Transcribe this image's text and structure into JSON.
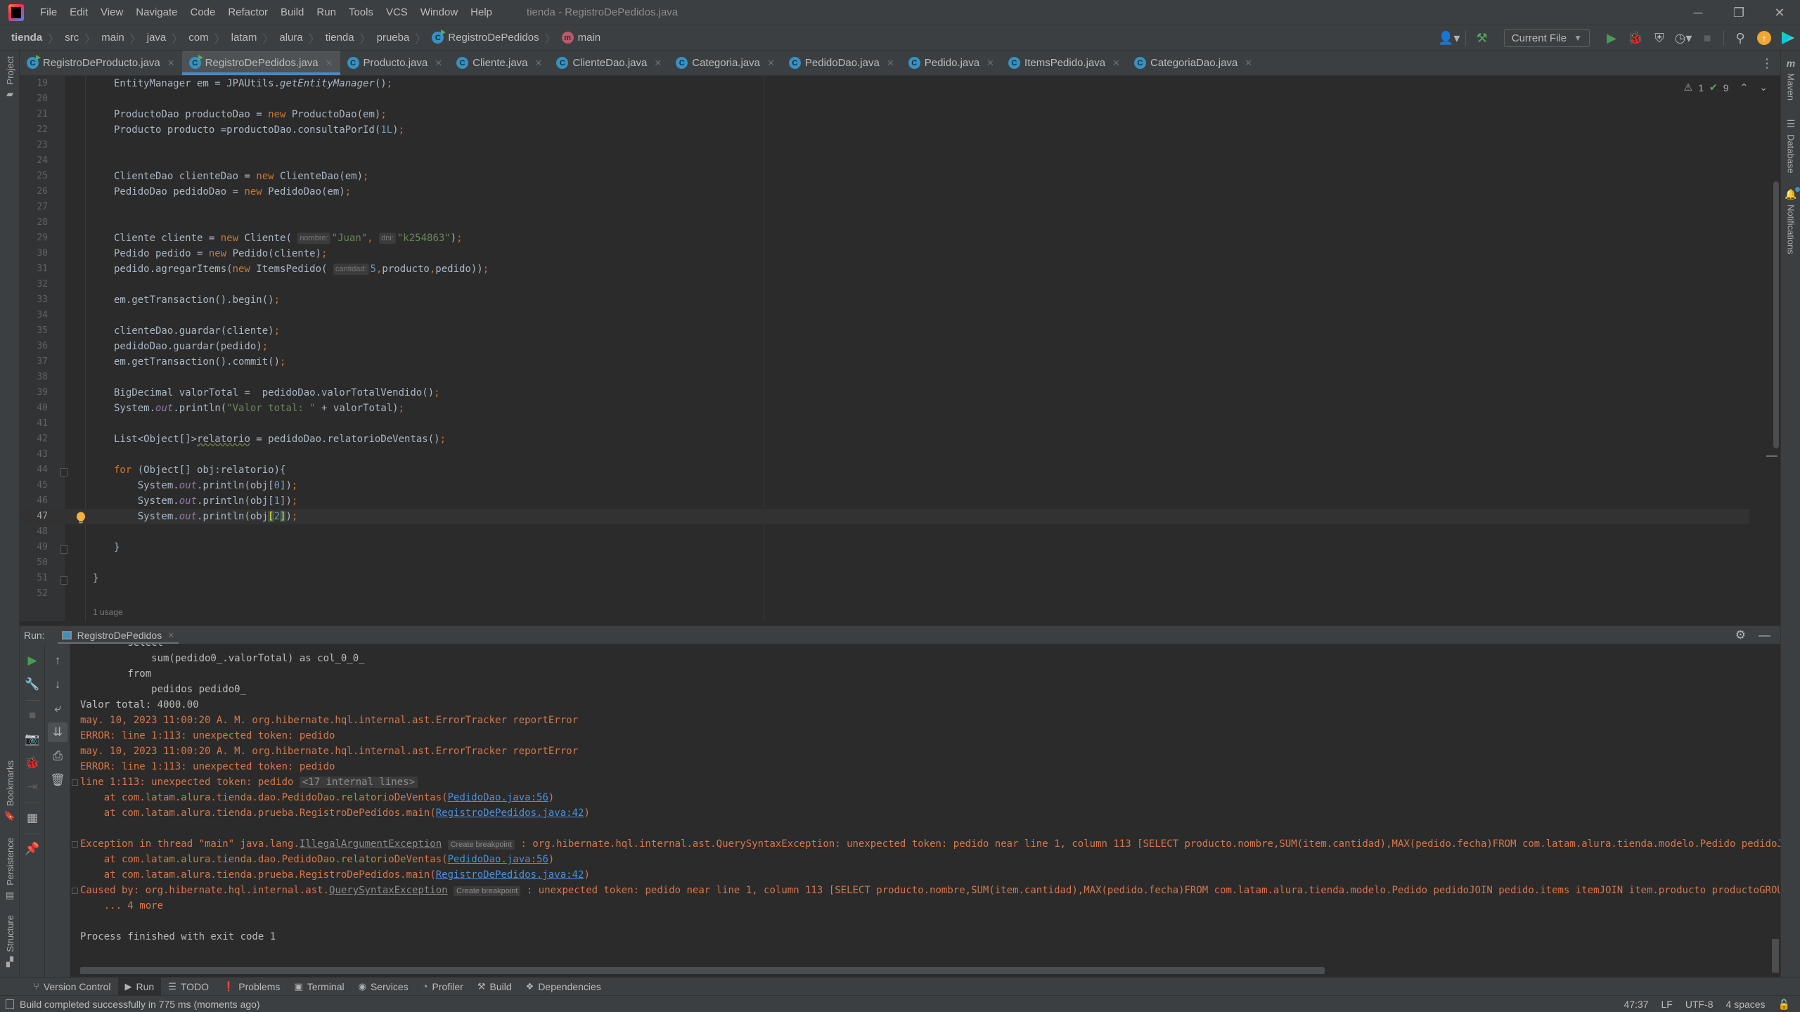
{
  "menu": {
    "items": [
      "File",
      "Edit",
      "View",
      "Navigate",
      "Code",
      "Refactor",
      "Build",
      "Run",
      "Tools",
      "VCS",
      "Window",
      "Help"
    ],
    "window_title": "tienda - RegistroDePedidos.java"
  },
  "window_controls": {
    "minimize": "─",
    "restore": "❐",
    "close": "✕"
  },
  "breadcrumbs": {
    "items": [
      "tienda",
      "src",
      "main",
      "java",
      "com",
      "latam",
      "alura",
      "tienda",
      "prueba"
    ],
    "class": "RegistroDePedidos",
    "method": "main"
  },
  "toolbar": {
    "run_config": "Current File",
    "icons": [
      "user-icon",
      "build-hammer-icon",
      "run-icon",
      "debug-icon",
      "coverage-icon",
      "profile-icon",
      "stop-icon",
      "search-icon",
      "update-icon",
      "toolbox-icon"
    ]
  },
  "editor_tabs": [
    {
      "label": "RegistroDeProducto.java",
      "runnable": true,
      "active": false
    },
    {
      "label": "RegistroDePedidos.java",
      "runnable": true,
      "active": true
    },
    {
      "label": "Producto.java",
      "runnable": false,
      "active": false
    },
    {
      "label": "Cliente.java",
      "runnable": false,
      "active": false
    },
    {
      "label": "ClienteDao.java",
      "runnable": false,
      "active": false
    },
    {
      "label": "Categoria.java",
      "runnable": false,
      "active": false
    },
    {
      "label": "PedidoDao.java",
      "runnable": false,
      "active": false
    },
    {
      "label": "Pedido.java",
      "runnable": false,
      "active": false
    },
    {
      "label": "ItemsPedido.java",
      "runnable": false,
      "active": false
    },
    {
      "label": "CategoriaDao.java",
      "runnable": false,
      "active": false
    }
  ],
  "inspections": {
    "warnings": "1",
    "checks": "9"
  },
  "left_tools": [
    "Project",
    "Bookmarks",
    "Persistence",
    "Structure"
  ],
  "right_tools": [
    "Maven",
    "Database",
    "Notifications"
  ],
  "editor": {
    "current_line": 47,
    "usage_hint": "1 usage",
    "lines": [
      {
        "n": "19",
        "html": "EntityManager em = JPAUtils.<span class=\"static\">getEntityManager</span>()<span class=\"semi\">;</span>"
      },
      {
        "n": "20",
        "html": ""
      },
      {
        "n": "21",
        "html": "ProductoDao productoDao = <span class=\"kw\">new</span> ProductoDao(em)<span class=\"semi\">;</span>"
      },
      {
        "n": "22",
        "html": "Producto producto =productoDao.consultaPorId(<span class=\"num\">1L</span>)<span class=\"semi\">;</span>"
      },
      {
        "n": "23",
        "html": ""
      },
      {
        "n": "24",
        "html": ""
      },
      {
        "n": "25",
        "html": "ClienteDao clienteDao = <span class=\"kw\">new</span> ClienteDao(em)<span class=\"semi\">;</span>"
      },
      {
        "n": "26",
        "html": "PedidoDao pedidoDao = <span class=\"kw\">new</span> PedidoDao(em)<span class=\"semi\">;</span>"
      },
      {
        "n": "27",
        "html": ""
      },
      {
        "n": "28",
        "html": ""
      },
      {
        "n": "29",
        "html": "Cliente cliente = <span class=\"kw\">new</span> Cliente( <span class=\"hint\">nombre:</span><span class=\"str\">\"Juan\"</span><span class=\"semi\">,</span> <span class=\"hint\">dni:</span><span class=\"str\">\"k254863\"</span>)<span class=\"semi\">;</span>"
      },
      {
        "n": "30",
        "html": "Pedido pedido = <span class=\"kw\">new</span> Pedido(cliente)<span class=\"semi\">;</span>"
      },
      {
        "n": "31",
        "html": "pedido.agregarItems(<span class=\"kw\">new</span> ItemsPedido( <span class=\"hint\">cantidad:</span><span class=\"num\">5</span><span class=\"semi\">,</span>producto<span class=\"semi\">,</span>pedido))<span class=\"semi\">;</span>"
      },
      {
        "n": "32",
        "html": ""
      },
      {
        "n": "33",
        "html": "em.getTransaction().begin()<span class=\"semi\">;</span>"
      },
      {
        "n": "34",
        "html": ""
      },
      {
        "n": "35",
        "html": "clienteDao.guardar(cliente)<span class=\"semi\">;</span>"
      },
      {
        "n": "36",
        "html": "pedidoDao.guardar(pedido)<span class=\"semi\">;</span>"
      },
      {
        "n": "37",
        "html": "em.getTransaction().commit()<span class=\"semi\">;</span>"
      },
      {
        "n": "38",
        "html": ""
      },
      {
        "n": "39",
        "html": "BigDecimal valorTotal =  pedidoDao.valorTotalVendido()<span class=\"semi\">;</span>"
      },
      {
        "n": "40",
        "html": "System.<span class=\"italic\">out</span>.println(<span class=\"str\">\"Valor total: \"</span> + valorTotal)<span class=\"semi\">;</span>"
      },
      {
        "n": "41",
        "html": ""
      },
      {
        "n": "42",
        "html": "List&lt;Object[]&gt;<span class=\"warn-under\">relatorio</span> = pedidoDao.relatorioDeVentas()<span class=\"semi\">;</span>"
      },
      {
        "n": "43",
        "html": ""
      },
      {
        "n": "44",
        "html": "<span class=\"kw\">for</span> (Object[] obj:relatorio){"
      },
      {
        "n": "45",
        "html": "    System.<span class=\"italic\">out</span>.println(obj[<span class=\"num\">0</span>])<span class=\"semi\">;</span>"
      },
      {
        "n": "46",
        "html": "    System.<span class=\"italic\">out</span>.println(obj[<span class=\"num\">1</span>])<span class=\"semi\">;</span>"
      },
      {
        "n": "47",
        "html": "    System.<span class=\"italic\">out</span>.println(obj<span class=\"brace-match\">[</span><span class=\"num\">2</span><span class=\"brace-match\">]</span>)<span class=\"semi\">;</span>"
      },
      {
        "n": "48",
        "html": ""
      },
      {
        "n": "49",
        "html": "}"
      },
      {
        "n": "50",
        "html": ""
      },
      {
        "n": "51",
        "html": "}",
        "indent": "outer"
      },
      {
        "n": "52",
        "html": ""
      }
    ]
  },
  "run_panel": {
    "label": "Run:",
    "tab": "RegistroDePedidos",
    "console": [
      {
        "type": "normal",
        "text": "        select"
      },
      {
        "type": "normal",
        "text": "            sum(pedido0_.valorTotal) as col_0_0_"
      },
      {
        "type": "normal",
        "text": "        from"
      },
      {
        "type": "normal",
        "text": "            pedidos pedido0_"
      },
      {
        "type": "normal",
        "text": "Valor total: 4000.00"
      },
      {
        "type": "err",
        "text": "may. 10, 2023 11:00:20 A. M. org.hibernate.hql.internal.ast.ErrorTracker reportError"
      },
      {
        "type": "err",
        "text": "ERROR: line 1:113: unexpected token: pedido"
      },
      {
        "type": "err",
        "text": "may. 10, 2023 11:00:20 A. M. org.hibernate.hql.internal.ast.ErrorTracker reportError"
      },
      {
        "type": "err",
        "text": "ERROR: line 1:113: unexpected token: pedido"
      },
      {
        "type": "err",
        "fold": true,
        "text": "line 1:113: unexpected token: pedido ",
        "internal": "<17 internal lines>"
      },
      {
        "type": "err",
        "text": "    at com.latam.alura.tienda.dao.PedidoDao.relatorioDeVentas(",
        "link": "PedidoDao.java:56",
        "after": ")"
      },
      {
        "type": "err",
        "text": "    at com.latam.alura.tienda.prueba.RegistroDePedidos.main(",
        "link": "RegistroDePedidos.java:42",
        "after": ")"
      },
      {
        "type": "blank",
        "text": ""
      },
      {
        "type": "err",
        "fold": true,
        "text": "Exception in thread \"main\" java.lang.",
        "exc": "IllegalArgumentException",
        "bp": "Create breakpoint",
        "after": " : org.hibernate.hql.internal.ast.QuerySyntaxException: unexpected token: pedido near line 1, column 113 [SELECT producto.nombre,SUM(item.cantidad),MAX(pedido.fecha)FROM com.latam.alura.tienda.modelo.Pedido pedidoJOIN pedido.items itemJOIN item.producto productoGROUP BY producto.nombre]"
      },
      {
        "type": "err",
        "text": "    at com.latam.alura.tienda.dao.PedidoDao.relatorioDeVentas(",
        "link": "PedidoDao.java:56",
        "after": ")"
      },
      {
        "type": "err",
        "text": "    at com.latam.alura.tienda.prueba.RegistroDePedidos.main(",
        "link": "RegistroDePedidos.java:42",
        "after": ")"
      },
      {
        "type": "err",
        "fold": true,
        "text": "Caused by: org.hibernate.hql.internal.ast.",
        "exc": "QuerySyntaxException",
        "bp": "Create breakpoint",
        "after": " : unexpected token: pedido near line 1, column 113 [SELECT producto.nombre,SUM(item.cantidad),MAX(pedido.fecha)FROM com.latam.alura.tienda.modelo.Pedido pedidoJOIN pedido.items itemJOIN item.producto productoGROUP BY producto.nombre]"
      },
      {
        "type": "err",
        "text": "    ... 4 more"
      },
      {
        "type": "blank",
        "text": ""
      },
      {
        "type": "normal",
        "text": "Process finished with exit code 1"
      }
    ]
  },
  "tool_windows": [
    {
      "label": "Version Control",
      "icon": "branch-icon",
      "glyph": "⑂",
      "active": false
    },
    {
      "label": "Run",
      "icon": "run-icon",
      "glyph": "▶",
      "active": true
    },
    {
      "label": "TODO",
      "icon": "list-icon",
      "glyph": "☰",
      "active": false
    },
    {
      "label": "Problems",
      "icon": "problems-icon",
      "glyph": "❗",
      "active": false
    },
    {
      "label": "Terminal",
      "icon": "terminal-icon",
      "glyph": "▣",
      "active": false
    },
    {
      "label": "Services",
      "icon": "services-icon",
      "glyph": "◉",
      "active": false
    },
    {
      "label": "Profiler",
      "icon": "profiler-icon",
      "glyph": "◔",
      "active": false
    },
    {
      "label": "Build",
      "icon": "hammer-icon",
      "glyph": "⚒",
      "active": false
    },
    {
      "label": "Dependencies",
      "icon": "dependencies-icon",
      "glyph": "❖",
      "active": false
    }
  ],
  "status": {
    "message": "Build completed successfully in 775 ms (moments ago)",
    "position": "47:37",
    "line_separator": "LF",
    "encoding": "UTF-8",
    "indent": "4 spaces"
  }
}
